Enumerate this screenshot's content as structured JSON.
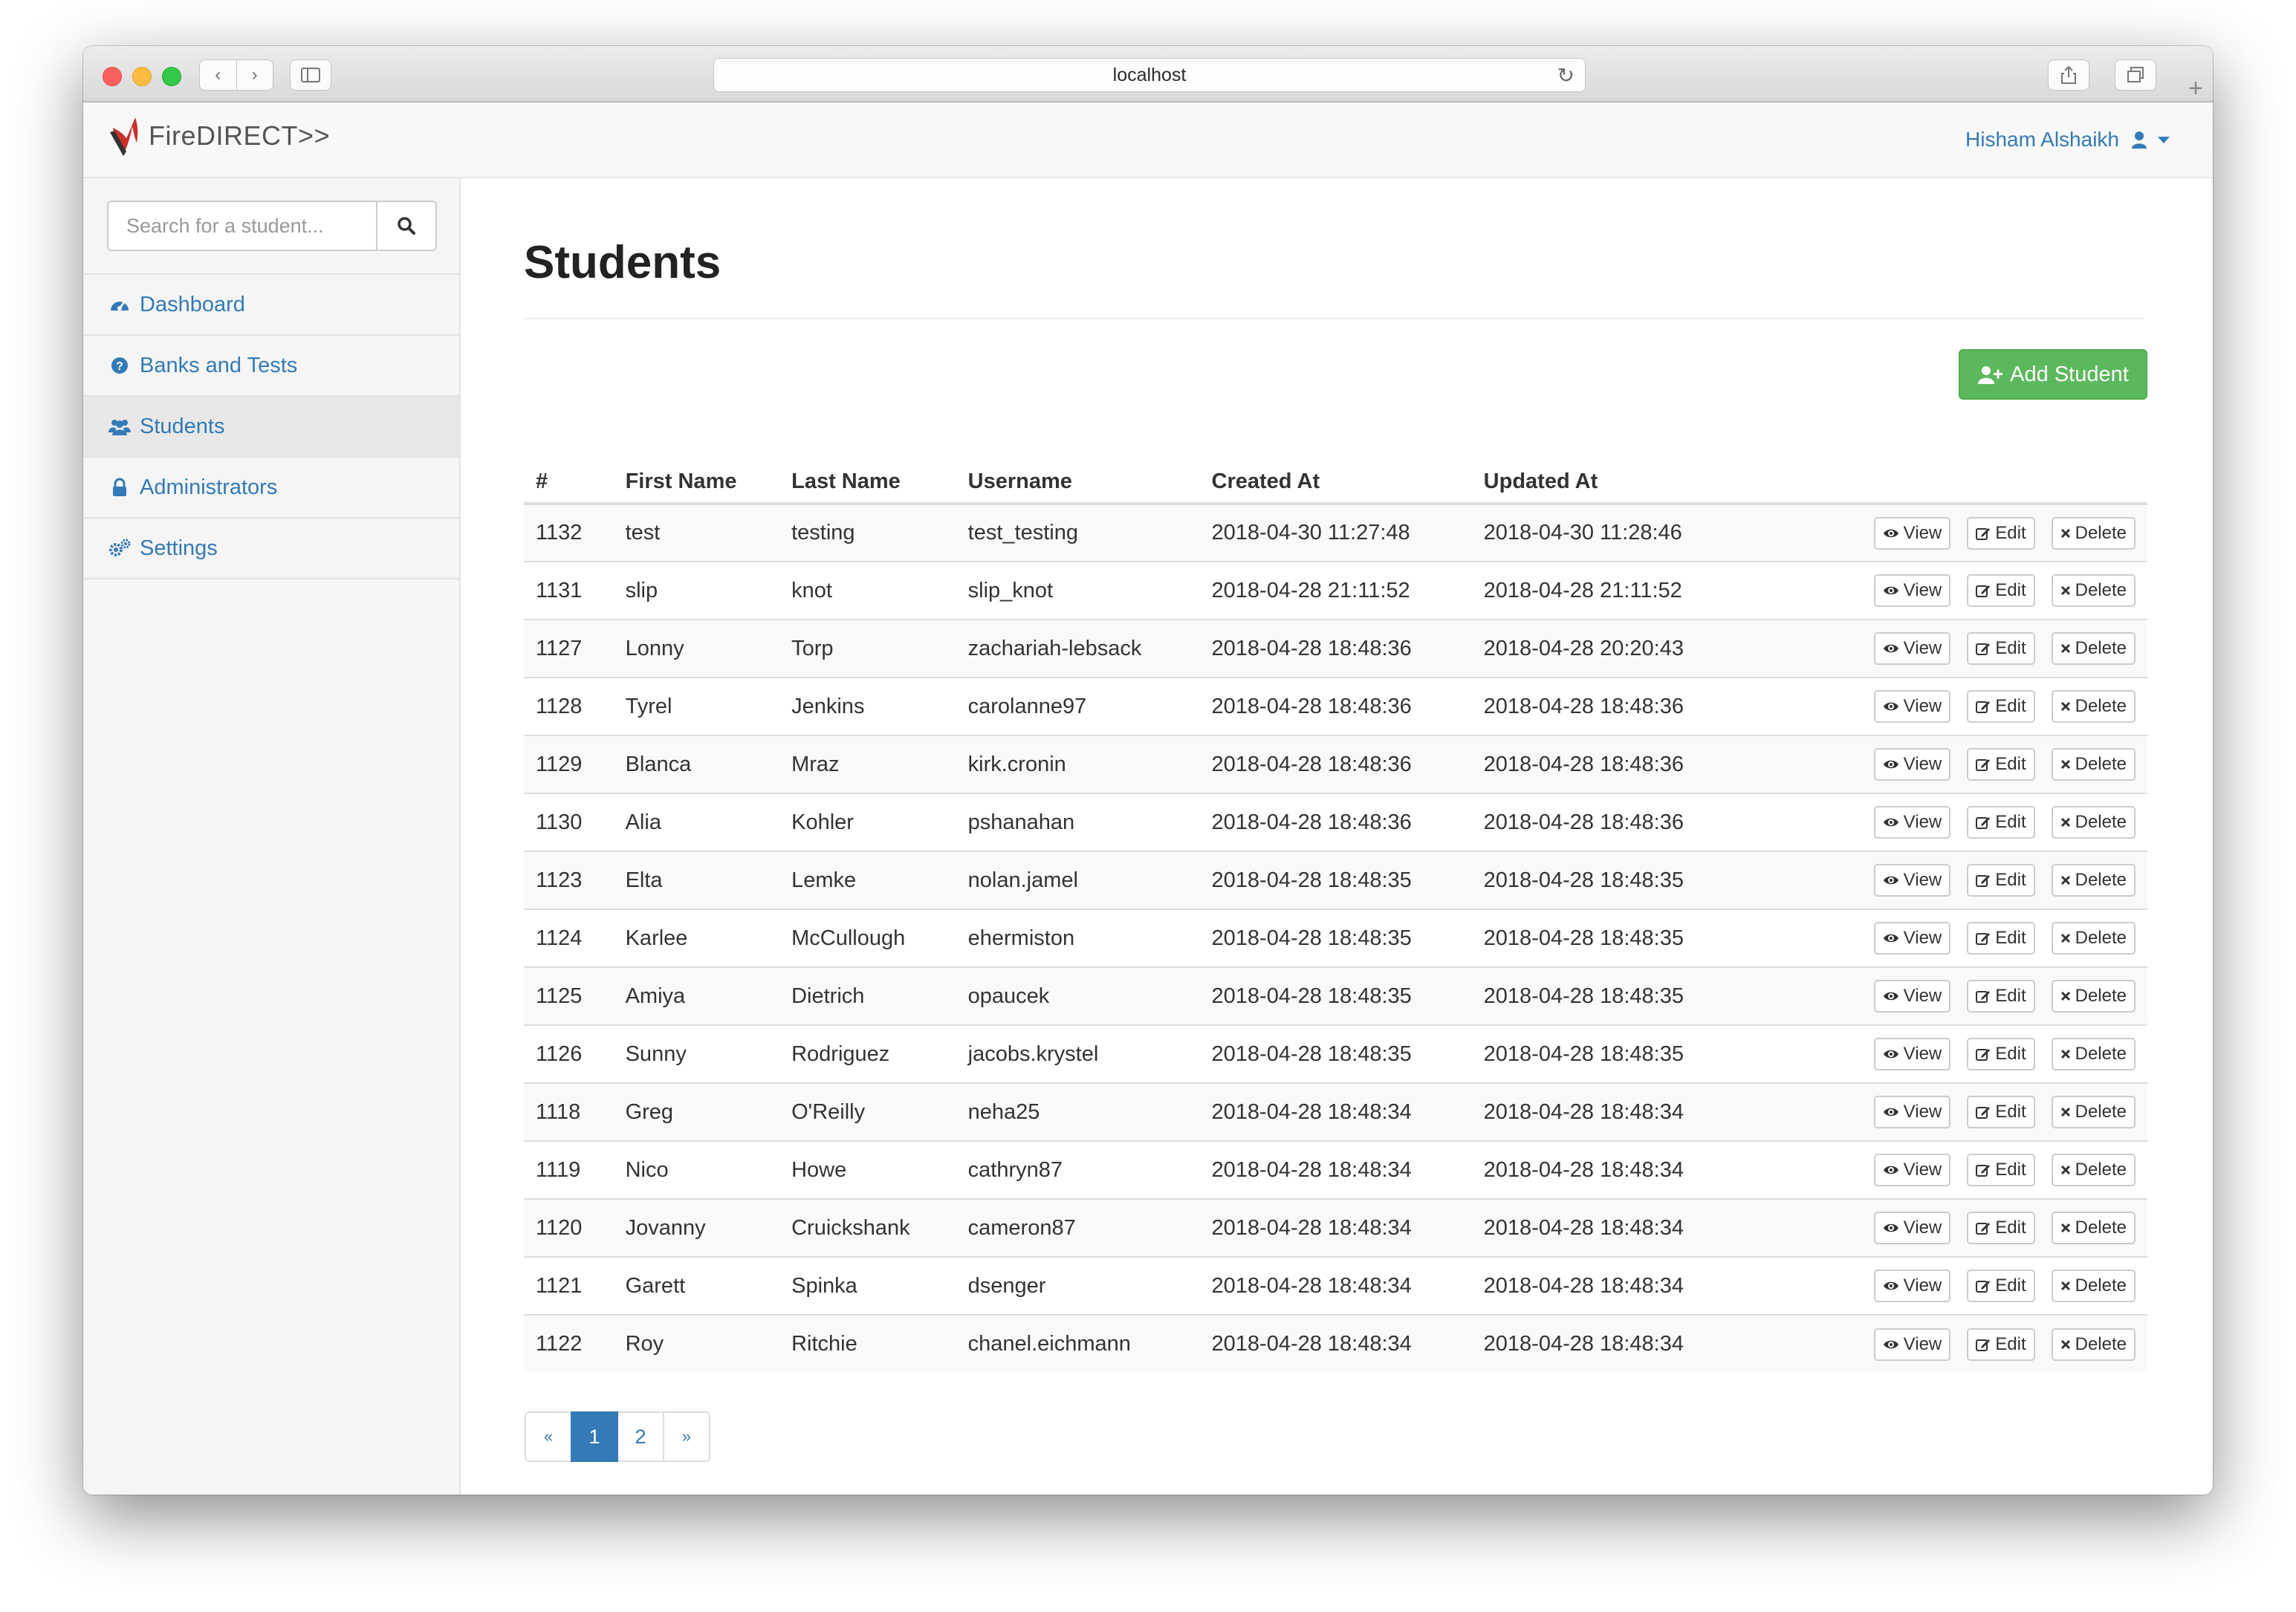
{
  "browser": {
    "url": "localhost"
  },
  "app": {
    "brand": "FireDIRECT>>",
    "user_name": "Hisham Alshaikh"
  },
  "sidebar": {
    "search_placeholder": "Search for a student...",
    "items": [
      {
        "label": "Dashboard",
        "icon": "dashboard-icon"
      },
      {
        "label": "Banks and Tests",
        "icon": "question-circle-icon"
      },
      {
        "label": "Students",
        "icon": "users-icon",
        "active": true
      },
      {
        "label": "Administrators",
        "icon": "lock-icon"
      },
      {
        "label": "Settings",
        "icon": "gears-icon"
      }
    ]
  },
  "main": {
    "title": "Students",
    "add_button_label": "Add Student",
    "table": {
      "headers": [
        "#",
        "First Name",
        "Last Name",
        "Username",
        "Created At",
        "Updated At"
      ],
      "rows": [
        [
          "1132",
          "test",
          "testing",
          "test_testing",
          "2018-04-30 11:27:48",
          "2018-04-30 11:28:46"
        ],
        [
          "1131",
          "slip",
          "knot",
          "slip_knot",
          "2018-04-28 21:11:52",
          "2018-04-28 21:11:52"
        ],
        [
          "1127",
          "Lonny",
          "Torp",
          "zachariah-lebsack",
          "2018-04-28 18:48:36",
          "2018-04-28 20:20:43"
        ],
        [
          "1128",
          "Tyrel",
          "Jenkins",
          "carolanne97",
          "2018-04-28 18:48:36",
          "2018-04-28 18:48:36"
        ],
        [
          "1129",
          "Blanca",
          "Mraz",
          "kirk.cronin",
          "2018-04-28 18:48:36",
          "2018-04-28 18:48:36"
        ],
        [
          "1130",
          "Alia",
          "Kohler",
          "pshanahan",
          "2018-04-28 18:48:36",
          "2018-04-28 18:48:36"
        ],
        [
          "1123",
          "Elta",
          "Lemke",
          "nolan.jamel",
          "2018-04-28 18:48:35",
          "2018-04-28 18:48:35"
        ],
        [
          "1124",
          "Karlee",
          "McCullough",
          "ehermiston",
          "2018-04-28 18:48:35",
          "2018-04-28 18:48:35"
        ],
        [
          "1125",
          "Amiya",
          "Dietrich",
          "opaucek",
          "2018-04-28 18:48:35",
          "2018-04-28 18:48:35"
        ],
        [
          "1126",
          "Sunny",
          "Rodriguez",
          "jacobs.krystel",
          "2018-04-28 18:48:35",
          "2018-04-28 18:48:35"
        ],
        [
          "1118",
          "Greg",
          "O'Reilly",
          "neha25",
          "2018-04-28 18:48:34",
          "2018-04-28 18:48:34"
        ],
        [
          "1119",
          "Nico",
          "Howe",
          "cathryn87",
          "2018-04-28 18:48:34",
          "2018-04-28 18:48:34"
        ],
        [
          "1120",
          "Jovanny",
          "Cruickshank",
          "cameron87",
          "2018-04-28 18:48:34",
          "2018-04-28 18:48:34"
        ],
        [
          "1121",
          "Garett",
          "Spinka",
          "dsenger",
          "2018-04-28 18:48:34",
          "2018-04-28 18:48:34"
        ],
        [
          "1122",
          "Roy",
          "Ritchie",
          "chanel.eichmann",
          "2018-04-28 18:48:34",
          "2018-04-28 18:48:34"
        ]
      ],
      "actions": {
        "view": "View",
        "edit": "Edit",
        "delete": "Delete"
      }
    },
    "pagination": {
      "prev": "«",
      "pages": [
        "1",
        "2"
      ],
      "current": "1",
      "next": "»"
    }
  },
  "colors": {
    "link": "#337ab7",
    "success": "#5cb85c",
    "brand_red": "#c9302c"
  }
}
